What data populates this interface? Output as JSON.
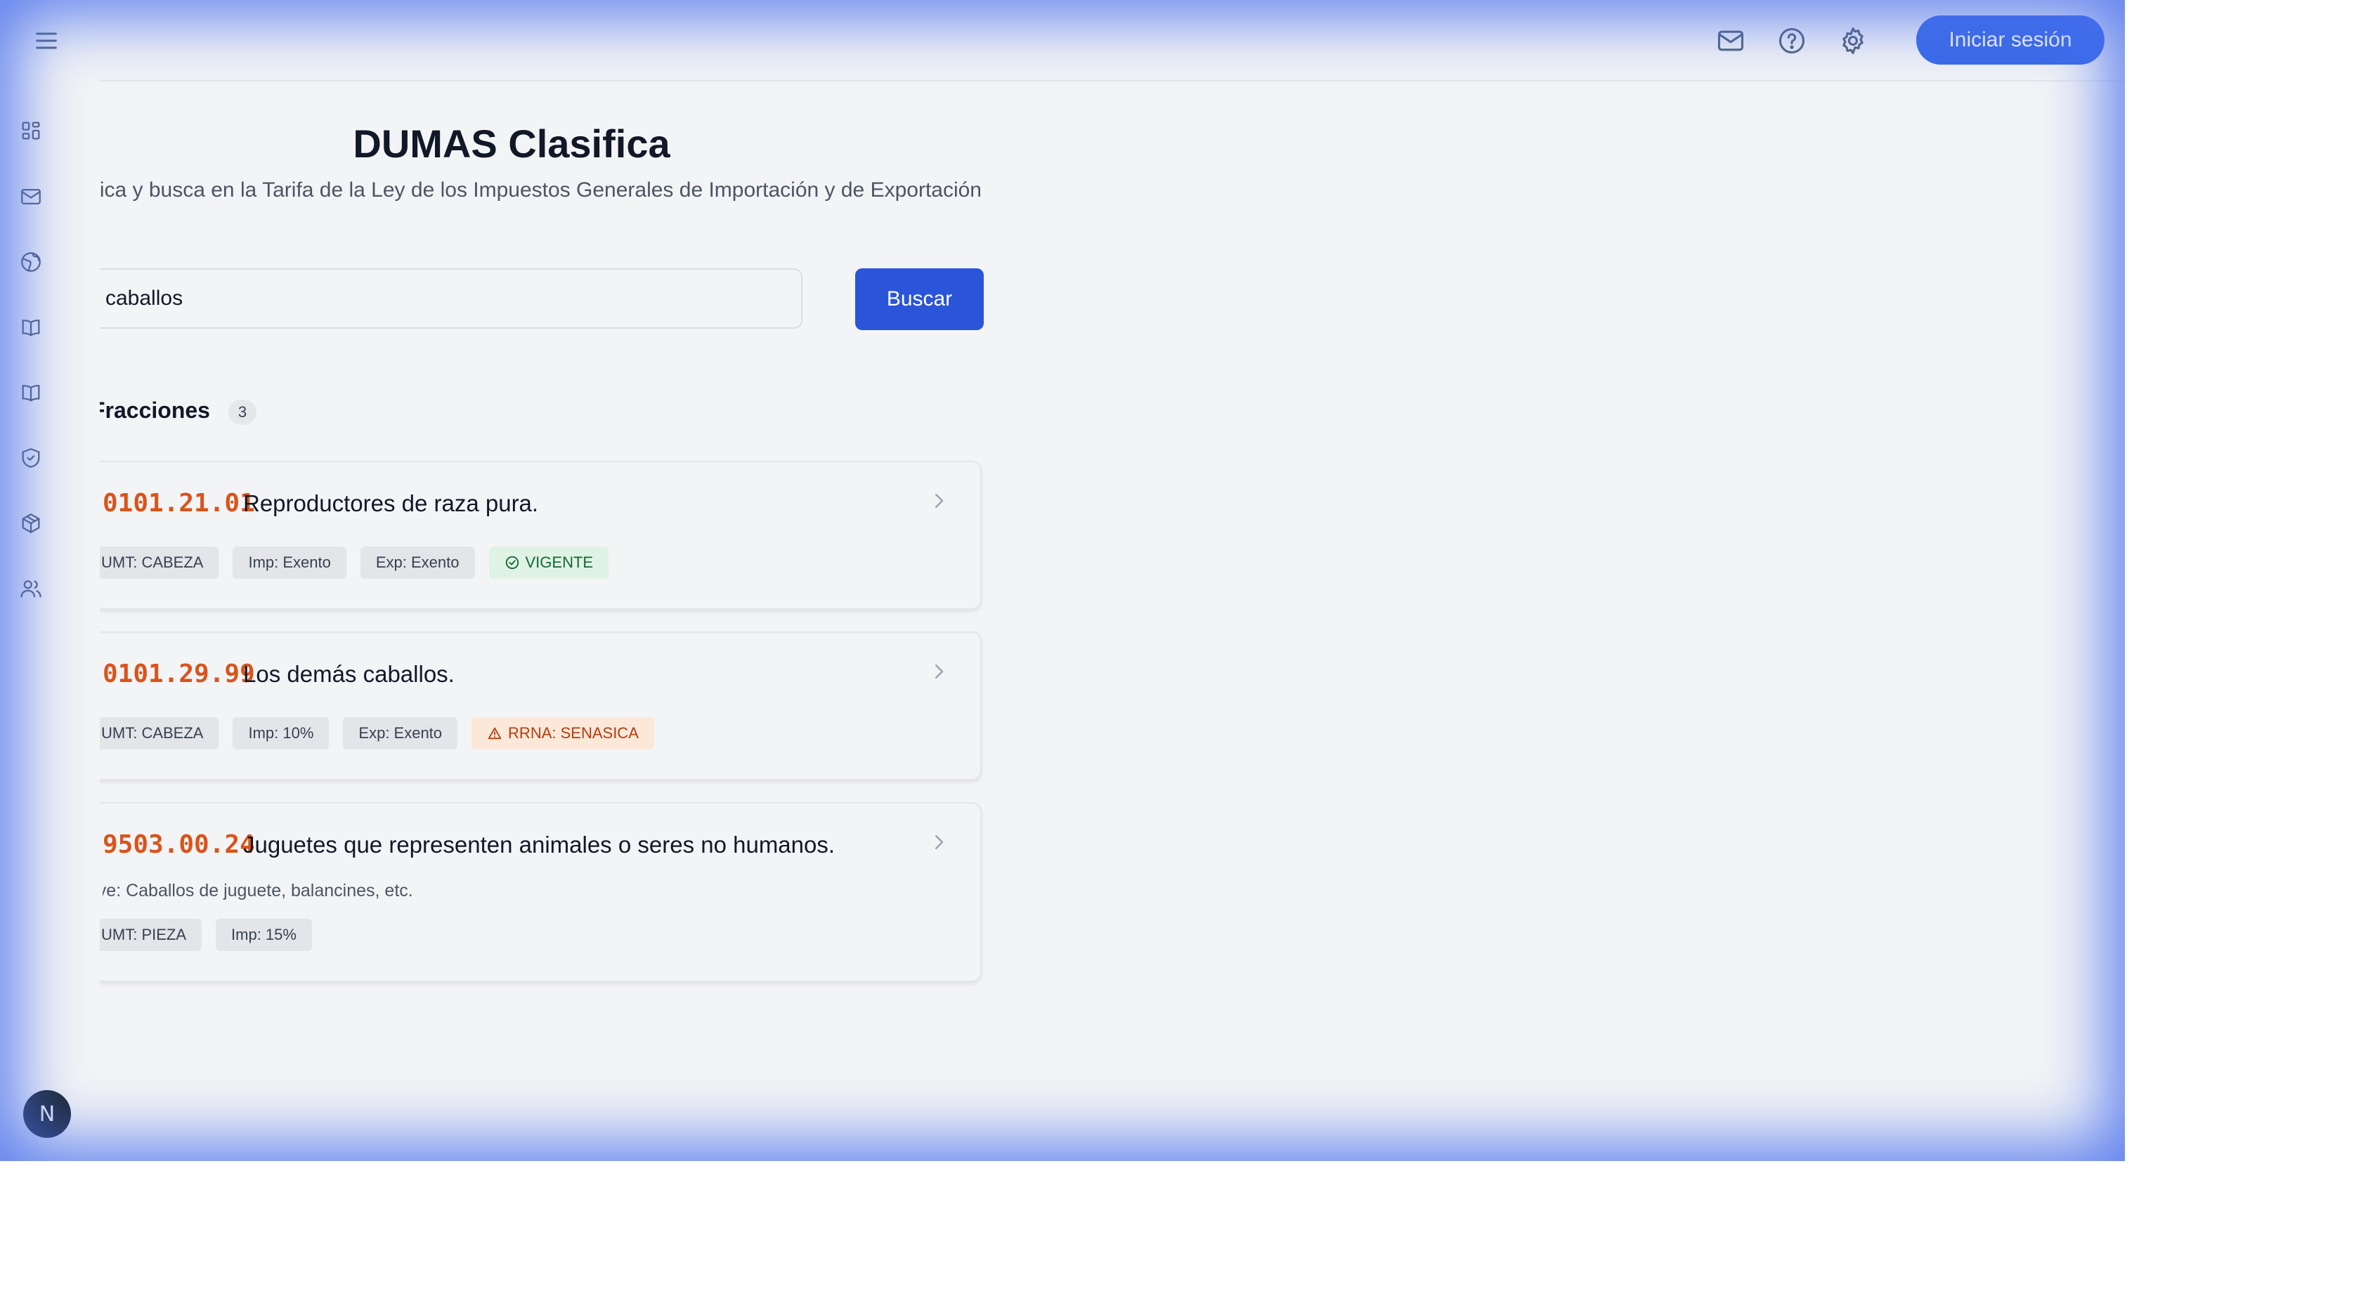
{
  "header": {
    "login_label": "Iniciar sesión",
    "icons": [
      "mail-icon",
      "help-icon",
      "gear-icon"
    ]
  },
  "sidebar": {
    "icons": [
      "menu-icon",
      "dashboard-icon",
      "mail-icon",
      "globe-icon",
      "book-icon",
      "book-open-icon",
      "shield-check-icon",
      "package-icon",
      "users-icon"
    ],
    "avatar_initial": "N"
  },
  "main": {
    "title": "DUMAS Clasifica",
    "subtitle": "Clasifica y busca en la Tarifa de la Ley de los Impuestos Generales de Importación y de Exportación",
    "search": {
      "value": "caballos",
      "button_label": "Buscar"
    },
    "section": {
      "title": "Fracciones",
      "count": "3"
    },
    "results": [
      {
        "code": "0101.21.01",
        "description": "Reproductores de raza pura.",
        "note": "",
        "tags": [
          {
            "label": "UMT: CABEZA",
            "kind": "neutral"
          },
          {
            "label": "Imp: Exento",
            "kind": "neutral"
          },
          {
            "label": "Exp: Exento",
            "kind": "neutral"
          },
          {
            "label": "VIGENTE",
            "kind": "green",
            "icon": "check-circle-icon"
          }
        ]
      },
      {
        "code": "0101.29.99",
        "description": "Los demás caballos.",
        "note": "",
        "tags": [
          {
            "label": "UMT: CABEZA",
            "kind": "neutral"
          },
          {
            "label": "Imp: 10%",
            "kind": "neutral"
          },
          {
            "label": "Exp: Exento",
            "kind": "neutral"
          },
          {
            "label": "RRNA: SENASICA",
            "kind": "orange",
            "icon": "warning-icon"
          }
        ]
      },
      {
        "code": "9503.00.24",
        "description": "Juguetes que representen animales o seres no humanos.",
        "note": "Incluye: Caballos de juguete, balancines, etc.",
        "tags": [
          {
            "label": "UMT: PIEZA",
            "kind": "neutral"
          },
          {
            "label": "Imp: 15%",
            "kind": "neutral"
          }
        ]
      }
    ]
  },
  "colors": {
    "primary": "#2b55d9",
    "code": "#d9541b",
    "glow": "#486eec"
  }
}
